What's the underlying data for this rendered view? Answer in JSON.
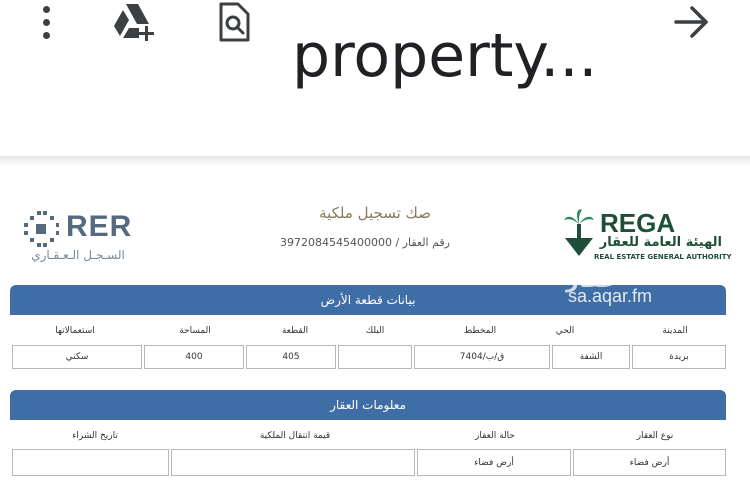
{
  "toolbar": {
    "title": "property...",
    "icons": [
      "more-vert-icon",
      "drive-add-icon",
      "find-in-page-icon",
      "forward-arrow-icon"
    ]
  },
  "document": {
    "left_logo": {
      "latin": "RER",
      "arabic": "السـجـل الـعـقـاري"
    },
    "right_logo": {
      "latin": "REGA",
      "arabic": "الهيئة العامة للعقار",
      "english": "REAL ESTATE GENERAL AUTHORITY"
    },
    "deed_title": "صك تسجيل ملكية",
    "property_number_label": "رقم العقار / 3972084545400000",
    "watermark": {
      "arabic": "عقار",
      "latin": "sa.aqar.fm"
    },
    "land_section": {
      "title": "بيانات قطعة الأرض",
      "headers": [
        "المدينة",
        "الحي",
        "المخطط",
        "البلك",
        "القطعة",
        "المساحة",
        "استعمالاتها"
      ],
      "values": [
        "بريدة",
        "الشفة",
        "ق/ب/7404",
        "",
        "405",
        "400",
        "سكني"
      ]
    },
    "property_section": {
      "title": "معلومات العقار",
      "headers": [
        "نوع العقار",
        "حالة العقار",
        "قيمة انتقال الملكية",
        "تاريخ الشراء"
      ],
      "values": [
        "أرض فضاء",
        "أرض فضاء",
        "",
        ""
      ]
    }
  }
}
